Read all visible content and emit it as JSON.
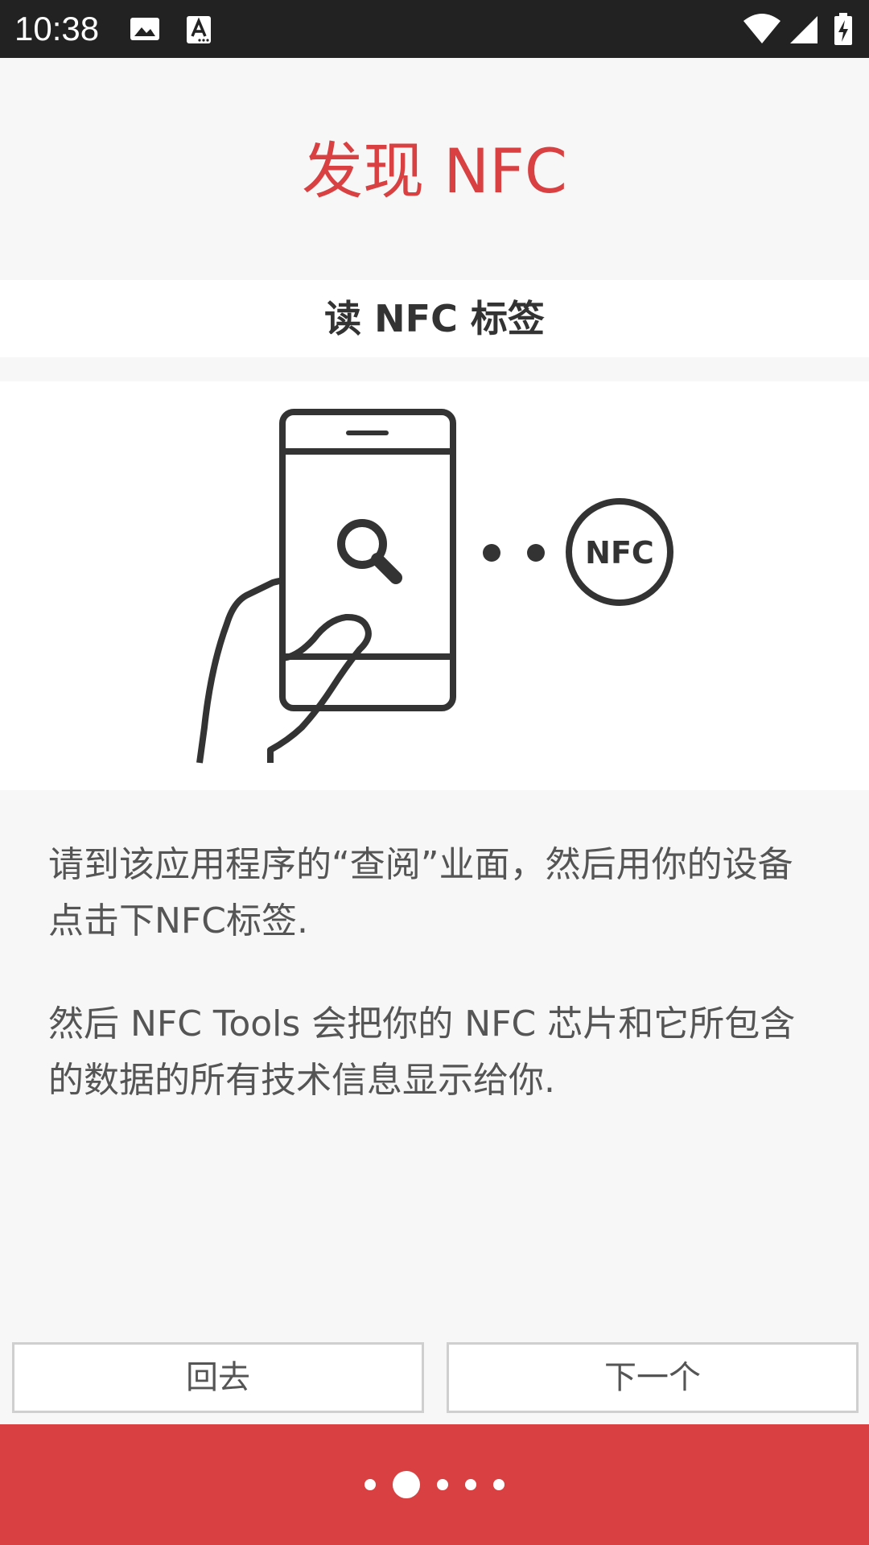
{
  "status_bar": {
    "time": "10:38",
    "icons": [
      "image-icon",
      "a-keyboard-icon",
      "wifi-icon",
      "signal-icon",
      "battery-charging-icon"
    ]
  },
  "header": {
    "title": "发现 NFC"
  },
  "section": {
    "subtitle": "读 NFC 标签"
  },
  "illustration": {
    "badge_label": "NFC"
  },
  "body": {
    "paragraph1": "请到该应用程序的“查阅”业面，然后用你的设备点击下NFC标签.",
    "paragraph2": "然后 NFC Tools 会把你的 NFC 芯片和它所包含的数据的所有技术信息显示给你."
  },
  "buttons": {
    "back_label": "回去",
    "next_label": "下一个"
  },
  "pager": {
    "total_pages": 5,
    "current_page": 2
  },
  "colors": {
    "accent": "#d84042",
    "status_bar": "#222222",
    "text": "#555555"
  }
}
